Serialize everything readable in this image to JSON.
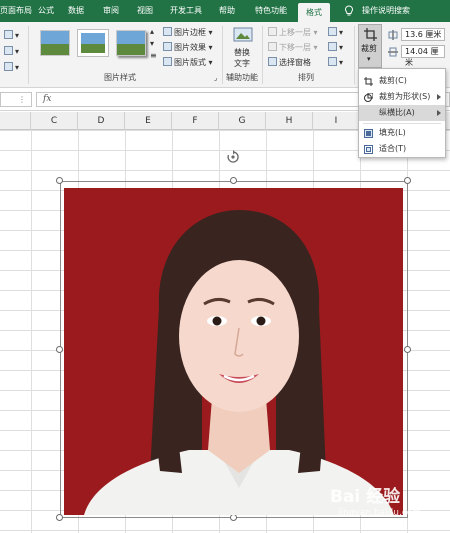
{
  "tabs": [
    {
      "label": "页面布局",
      "active": false
    },
    {
      "label": "公式",
      "active": false
    },
    {
      "label": "数据",
      "active": false
    },
    {
      "label": "审阅",
      "active": false
    },
    {
      "label": "视图",
      "active": false
    },
    {
      "label": "开发工具",
      "active": false
    },
    {
      "label": "帮助",
      "active": false
    },
    {
      "label": "特色功能",
      "active": false
    },
    {
      "label": "格式",
      "active": true
    }
  ],
  "tell_me": "操作说明搜索",
  "ribbon": {
    "picture_styles": {
      "group_label": "图片样式",
      "commands": [
        "图片边框",
        "图片效果",
        "图片版式"
      ]
    },
    "accessibility": {
      "group_label": "辅助功能",
      "alt_text_line1": "替换",
      "alt_text_line2": "文字"
    },
    "arrange": {
      "group_label": "排列",
      "bring_forward": "上移一层",
      "send_backward": "下移一层",
      "selection_pane": "选择窗格"
    },
    "size": {
      "crop_label": "裁剪",
      "height": "13.6 厘米",
      "width": "14.04 厘米"
    }
  },
  "formula_bar": {
    "fx": "fx"
  },
  "columns": [
    "C",
    "D",
    "E",
    "F",
    "G",
    "H",
    "I",
    "J"
  ],
  "crop_menu": [
    {
      "label": "裁剪(C)",
      "highlighted": false,
      "submenu": false,
      "icon": "crop-icon"
    },
    {
      "label": "裁剪为形状(S)",
      "highlighted": false,
      "submenu": true,
      "icon": "shape-icon"
    },
    {
      "label": "纵横比(A)",
      "highlighted": true,
      "submenu": true,
      "icon": ""
    },
    {
      "label": "填充(L)",
      "highlighted": false,
      "submenu": false,
      "icon": "fill-icon"
    },
    {
      "label": "适合(T)",
      "highlighted": false,
      "submenu": false,
      "icon": "fit-icon"
    }
  ],
  "watermark": {
    "brand": "Bai 经验",
    "url": "jingyan.baidu.com"
  },
  "colors": {
    "excel_green": "#217346",
    "portrait_background": "#9b1a1d",
    "cursor_highlight": "#ffee00"
  }
}
